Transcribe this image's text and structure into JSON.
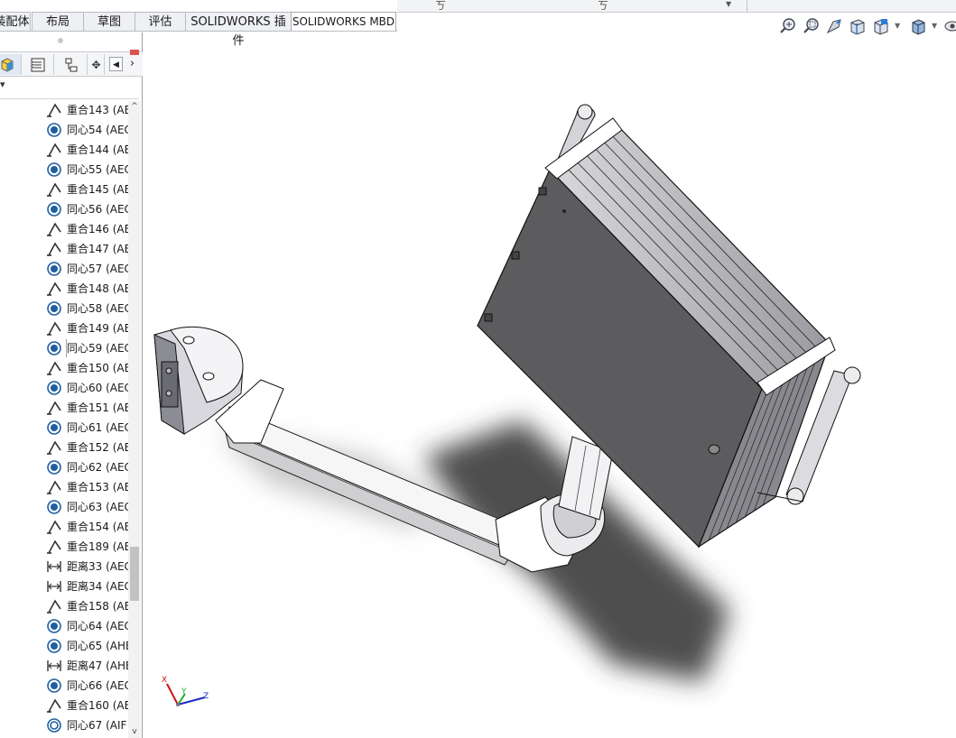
{
  "ribbon_tabs": [
    {
      "label": "装配体",
      "active": false
    },
    {
      "label": "布局",
      "active": false
    },
    {
      "label": "草图",
      "active": false
    },
    {
      "label": "评估",
      "active": false
    },
    {
      "label": "SOLIDWORKS 插件",
      "active": false
    },
    {
      "label": "SOLIDWORKS MBD",
      "active": true
    }
  ],
  "heads_up_toolbar": {
    "tools": [
      "zoom-to-fit-icon",
      "zoom-to-area-icon",
      "previous-view-icon",
      "section-view-icon",
      "view-orientation-icon",
      "display-style-icon"
    ]
  },
  "feature_manager": {
    "tabs": [
      "featuremanager-tree-icon",
      "property-manager-icon",
      "configuration-manager-icon"
    ],
    "mates": [
      {
        "type": "coincident",
        "label": "重合143 (AE"
      },
      {
        "type": "concentric",
        "label": "同心54 (AEC"
      },
      {
        "type": "coincident",
        "label": "重合144 (AE"
      },
      {
        "type": "concentric",
        "label": "同心55 (AEC"
      },
      {
        "type": "coincident",
        "label": "重合145 (AE"
      },
      {
        "type": "concentric",
        "label": "同心56 (AEC"
      },
      {
        "type": "coincident",
        "label": "重合146 (AE"
      },
      {
        "type": "coincident",
        "label": "重合147 (AE"
      },
      {
        "type": "concentric",
        "label": "同心57 (AEC"
      },
      {
        "type": "coincident",
        "label": "重合148 (AE"
      },
      {
        "type": "concentric",
        "label": "同心58 (AEC"
      },
      {
        "type": "coincident",
        "label": "重合149 (AE"
      },
      {
        "type": "concentric",
        "label": "同心59 (AEC",
        "selected": true
      },
      {
        "type": "coincident",
        "label": "重合150 (AE"
      },
      {
        "type": "concentric",
        "label": "同心60 (AEC"
      },
      {
        "type": "coincident",
        "label": "重合151 (AE"
      },
      {
        "type": "concentric",
        "label": "同心61 (AEC"
      },
      {
        "type": "coincident",
        "label": "重合152 (AE"
      },
      {
        "type": "concentric",
        "label": "同心62 (AEC"
      },
      {
        "type": "coincident",
        "label": "重合153 (AE"
      },
      {
        "type": "concentric",
        "label": "同心63 (AEC"
      },
      {
        "type": "coincident",
        "label": "重合154 (AE"
      },
      {
        "type": "coincident",
        "label": "重合189 (AE"
      },
      {
        "type": "distance",
        "label": "距离33 (AEC"
      },
      {
        "type": "distance",
        "label": "距离34 (AEC"
      },
      {
        "type": "coincident",
        "label": "重合158 (AE"
      },
      {
        "type": "concentric",
        "label": "同心64 (AEC"
      },
      {
        "type": "concentric",
        "label": "同心65 (AHE"
      },
      {
        "type": "distance",
        "label": "距离47 (AHE"
      },
      {
        "type": "concentric",
        "label": "同心66 (AEC"
      },
      {
        "type": "coincident",
        "label": "重合160 (AE"
      },
      {
        "type": "concentric-outline",
        "label": "同心67 (AIF"
      }
    ]
  },
  "triad": {
    "x": "X",
    "y": "Y",
    "z": "Z"
  },
  "colors": {
    "x_axis": "#cc1111",
    "y_axis": "#22aa22",
    "z_axis": "#1a2ccc",
    "mate_icon": "#1f5f9f"
  }
}
